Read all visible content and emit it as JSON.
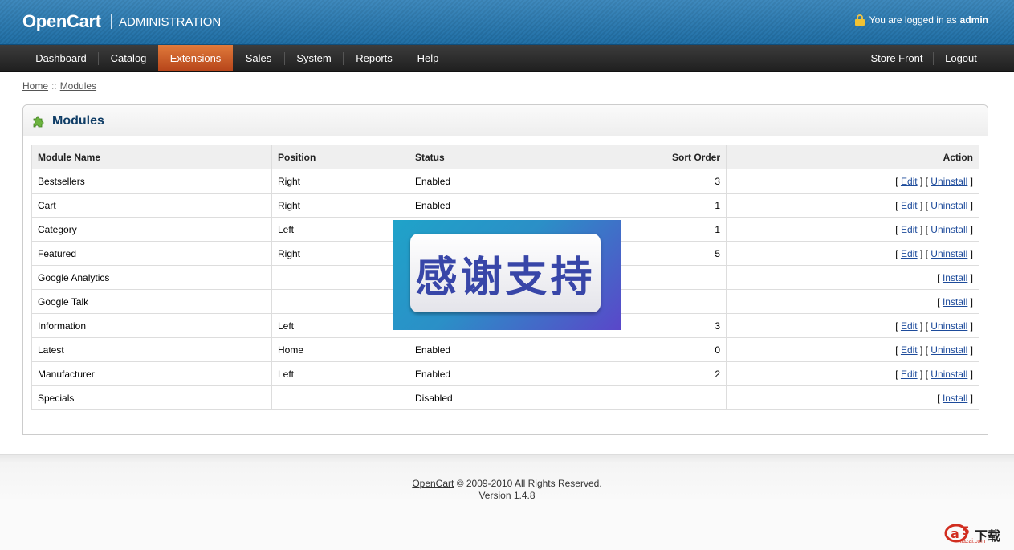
{
  "header": {
    "logo": "OpenCart",
    "subtitle": "ADMINISTRATION",
    "login_prefix": "You are logged in as",
    "login_user": "admin"
  },
  "menu": {
    "items": [
      "Dashboard",
      "Catalog",
      "Extensions",
      "Sales",
      "System",
      "Reports",
      "Help"
    ],
    "active": "Extensions",
    "right_items": [
      "Store Front",
      "Logout"
    ]
  },
  "breadcrumb": {
    "home": "Home",
    "separator": "::",
    "current": "Modules"
  },
  "box": {
    "title": "Modules"
  },
  "table": {
    "columns": [
      "Module Name",
      "Position",
      "Status",
      "Sort Order",
      "Action"
    ],
    "rows": [
      {
        "name": "Bestsellers",
        "position": "Right",
        "status": "Enabled",
        "sort": "3",
        "installed": true
      },
      {
        "name": "Cart",
        "position": "Right",
        "status": "Enabled",
        "sort": "1",
        "installed": true
      },
      {
        "name": "Category",
        "position": "Left",
        "status": "",
        "sort": "1",
        "installed": true
      },
      {
        "name": "Featured",
        "position": "Right",
        "status": "",
        "sort": "5",
        "installed": true
      },
      {
        "name": "Google Analytics",
        "position": "",
        "status": "",
        "sort": "",
        "installed": false
      },
      {
        "name": "Google Talk",
        "position": "",
        "status": "",
        "sort": "",
        "installed": false
      },
      {
        "name": "Information",
        "position": "Left",
        "status": "",
        "sort": "3",
        "installed": true
      },
      {
        "name": "Latest",
        "position": "Home",
        "status": "Enabled",
        "sort": "0",
        "installed": true
      },
      {
        "name": "Manufacturer",
        "position": "Left",
        "status": "Enabled",
        "sort": "2",
        "installed": true
      },
      {
        "name": "Specials",
        "position": "",
        "status": "Disabled",
        "sort": "",
        "installed": false
      }
    ],
    "edit_label": "Edit",
    "uninstall_label": "Uninstall",
    "install_label": "Install"
  },
  "overlay": {
    "text": "感谢支持"
  },
  "footer": {
    "brand": "OpenCart",
    "copyright": "© 2009-2010 All Rights Reserved.",
    "version": "Version 1.4.8"
  },
  "watermark": {
    "text": "下载",
    "sub": "xiazai.com"
  },
  "colors": {
    "header_blue": "#1f6fa6",
    "menu_dark": "#2a2a2a",
    "active_orange": "#c95a25",
    "title_navy": "#0f3d66"
  }
}
